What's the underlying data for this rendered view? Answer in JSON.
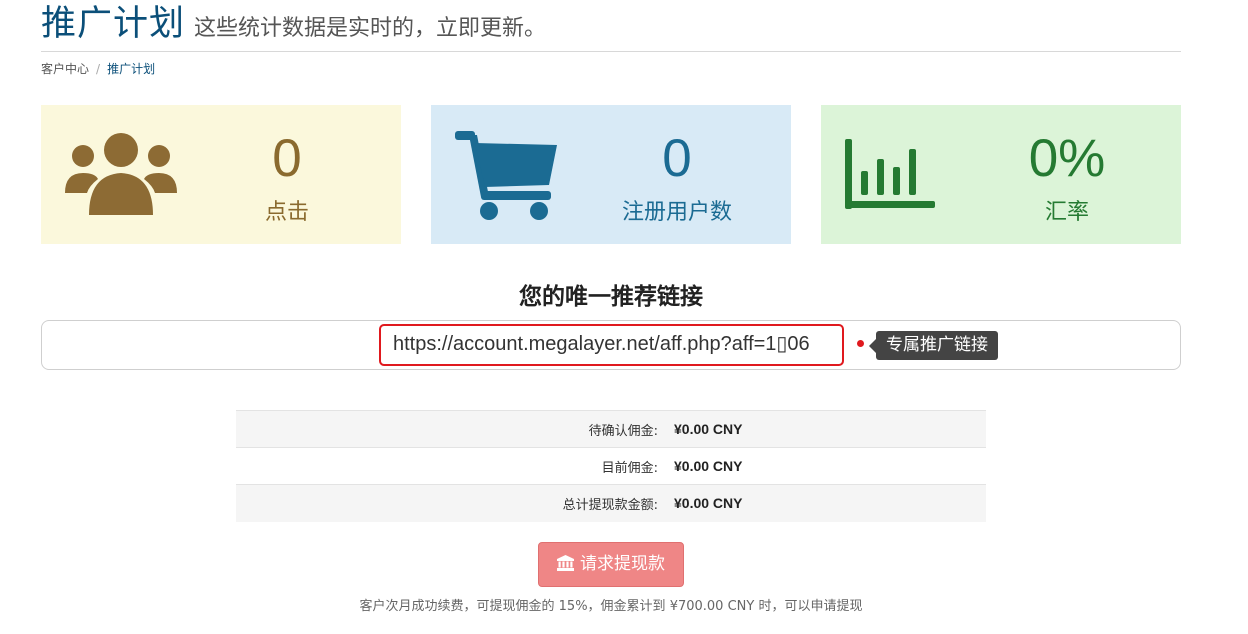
{
  "header": {
    "title": "推广计划",
    "subtitle": "这些统计数据是实时的，立即更新。"
  },
  "breadcrumb": {
    "home": "客户中心",
    "separator": "/",
    "current": "推广计划"
  },
  "stats": {
    "clicks": {
      "value": "0",
      "label": "点击",
      "icon": "users-icon",
      "color": "#8a6a2e",
      "bg": "#fbf8dc"
    },
    "signups": {
      "value": "0",
      "label": "注册用户数",
      "icon": "shopping-cart-icon",
      "color": "#1b6b93",
      "bg": "#d8eaf6"
    },
    "conversion": {
      "value": "0%",
      "label": "汇率",
      "icon": "bar-chart-icon",
      "color": "#257a32",
      "bg": "#dcf4d8"
    }
  },
  "referral": {
    "heading": "您的唯一推荐链接",
    "link": "https://account.megalayer.net/aff.php?aff=1▯06",
    "annotation": "专属推广链接",
    "highlight_color": "#e0191e"
  },
  "commissions": [
    {
      "label": "待确认佣金:",
      "value": "¥0.00 CNY"
    },
    {
      "label": "目前佣金:",
      "value": "¥0.00 CNY"
    },
    {
      "label": "总计提现款金额:",
      "value": "¥0.00 CNY"
    }
  ],
  "withdraw_button": {
    "label": "请求提现款",
    "icon": "bank-icon",
    "color": "#ef8686"
  },
  "footnote": "客户次月成功续费，可提现佣金的 15%，佣金累计到 ¥700.00 CNY 时，可以申请提现"
}
